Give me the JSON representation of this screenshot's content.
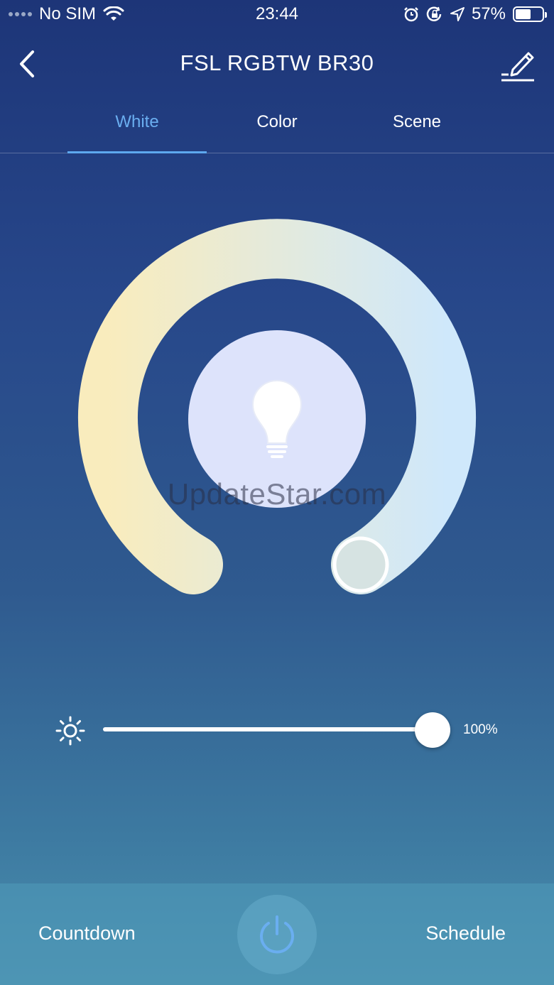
{
  "status_bar": {
    "carrier": "No SIM",
    "time": "23:44",
    "battery": "57%",
    "battery_level": 0.57,
    "icons": [
      "signal-dots-icon",
      "wifi-icon",
      "alarm-icon",
      "rotation-lock-icon",
      "location-icon",
      "battery-icon"
    ]
  },
  "nav": {
    "title": "FSL RGBTW BR30",
    "back_icon": "chevron-left-icon",
    "edit_icon": "pencil-icon"
  },
  "tabs": [
    {
      "label": "White",
      "active": true
    },
    {
      "label": "Color",
      "active": false
    },
    {
      "label": "Scene",
      "active": false
    }
  ],
  "temperature_dial": {
    "warm_color": "#f9ecbd",
    "cool_color": "#cfe8fb",
    "center_color": "#dde3fb",
    "value": 1.0,
    "center_icon": "lightbulb-icon"
  },
  "watermark": "UpdateStar.com",
  "brightness": {
    "icon": "sun-icon",
    "value": "100%",
    "level": 1.0
  },
  "bottom": {
    "countdown_label": "Countdown",
    "schedule_label": "Schedule",
    "power_icon": "power-icon",
    "power_color": "#6aaef0"
  },
  "colors": {
    "accent": "#6aaef0",
    "background_top": "#1d3578",
    "background_bottom": "#4a8fae"
  }
}
